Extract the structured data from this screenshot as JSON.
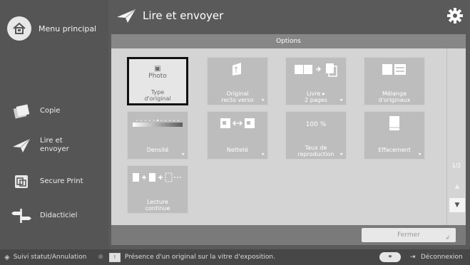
{
  "sidebar": {
    "home_label": "Menu principal",
    "items": [
      {
        "label": "Copie",
        "icon": "copy-icon"
      },
      {
        "label": "Lire et\nenvoyer",
        "icon": "send-icon"
      },
      {
        "label": "Secure Print",
        "icon": "secure-print-icon"
      },
      {
        "label": "Didacticiel",
        "icon": "tutorial-icon"
      }
    ]
  },
  "header": {
    "title": "Lire et envoyer",
    "icon": "gear-icon"
  },
  "panel": {
    "options_title": "Options",
    "close_label": "Fermer",
    "page_indicator": "1/2"
  },
  "tiles": [
    {
      "art_text": "Photo",
      "label": "Type\nd'original",
      "arrow": false
    },
    {
      "art_text": "",
      "label": "Original\nrecto verso",
      "arrow": true
    },
    {
      "art_text": "",
      "label": "Livre ▸\n2 pages",
      "arrow": true
    },
    {
      "art_text": "",
      "label": "Mélange\nd'originaux",
      "arrow": false
    },
    {
      "art_text": "",
      "label": "Densité",
      "arrow": true
    },
    {
      "art_text": "",
      "label": "Netteté",
      "arrow": true
    },
    {
      "art_text": "100 %",
      "label": "Taux de\nreproduction",
      "arrow": true
    },
    {
      "art_text": "",
      "label": "Effacement",
      "arrow": true
    },
    {
      "art_text": "",
      "label": "Lecture\ncontinue",
      "arrow": false
    }
  ],
  "status": {
    "left_label": "Suivi statut/Annulation",
    "message": "Présence d'un original sur la vitre d'exposition.",
    "logout_label": "Déconnexion"
  }
}
